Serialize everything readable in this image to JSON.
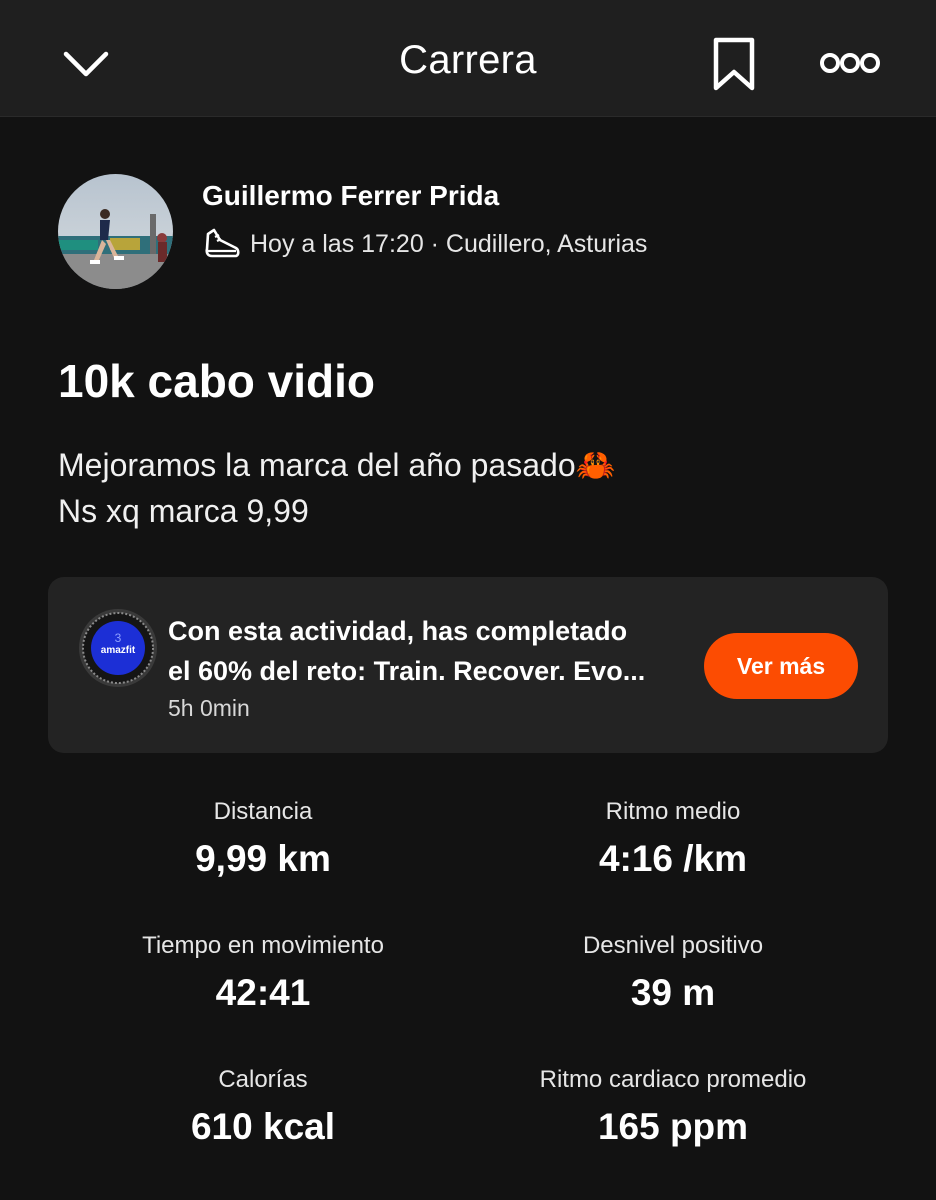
{
  "header": {
    "title": "Carrera",
    "icons": [
      "chevron-down-icon",
      "bookmark-icon",
      "more-icon"
    ]
  },
  "athlete": {
    "name": "Guillermo Ferrer Prida",
    "meta": "Hoy a las 17:20 · Cudillero, Asturias",
    "activity_icon": "running-shoe-icon"
  },
  "activity": {
    "title": "10k cabo vidio",
    "description": [
      "Mejoramos la marca del año pasado🦀",
      "Ns xq marca 9,99"
    ]
  },
  "challenge": {
    "badge_text": "amazfit",
    "lines": [
      "Con esta actividad, has completado",
      "el 60% del reto: Train. Recover. Evo..."
    ],
    "time": "5h 0min",
    "button": "Ver más"
  },
  "stats": [
    {
      "label": "Distancia",
      "value": "9,99 km"
    },
    {
      "label": "Ritmo medio",
      "value": "4:16 /km"
    },
    {
      "label": "Tiempo en movimiento",
      "value": "42:41"
    },
    {
      "label": "Desnivel positivo",
      "value": "39 m"
    },
    {
      "label": "Calorías",
      "value": "610 kcal"
    },
    {
      "label": "Ritmo cardiaco promedio",
      "value": "165 ppm"
    }
  ],
  "colors": {
    "background": "#121212",
    "header_background": "#1f1f1f",
    "card_background": "#232323",
    "accent": "#fc4c02",
    "badge_blue": "#1c2fd6"
  }
}
